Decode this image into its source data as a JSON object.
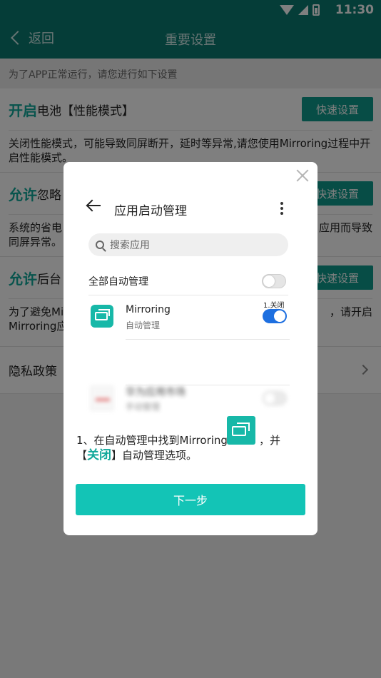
{
  "status": {
    "time": "11:30"
  },
  "nav": {
    "back_label": "返回",
    "title": "重要设置"
  },
  "hint": "为了APP正常运行，请您进行如下设置",
  "sections": [
    {
      "prefix": "开启",
      "title": "电池【性能模式】",
      "button": "快速设置",
      "desc": "关闭性能模式，可能导致同屏断开，延时等异常,请您使用Mirroring过程中开启性能模式。"
    },
    {
      "prefix": "允许",
      "title": "忽略",
      "button": "快速设置",
      "desc": "系统的省电",
      "desc_right": "应用而导致",
      "desc2": "同屏异常。"
    },
    {
      "prefix": "允许",
      "title": "后台",
      "button": "快速设置",
      "desc": "为了避免Mi",
      "desc_right": "，请开启",
      "desc2": "Mirroring应"
    }
  ],
  "privacy": {
    "label": "隐私政策"
  },
  "dialog": {
    "mock": {
      "title": "应用启动管理",
      "search_placeholder": "搜索应用",
      "all_label": "全部自动管理",
      "app_name": "Mirroring",
      "app_sub": "自动管理",
      "close_hint": "1.关闭",
      "blur_name": "华为应用市场",
      "blur_sub": "手动管理"
    },
    "instr_line1_a": "1、在自动管理中找到Mirroring",
    "instr_line1_b": "，并",
    "instr_line2_a": "【",
    "instr_line2_hl": "关闭",
    "instr_line2_b": "】自动管理选项。",
    "next_label": "下一步"
  },
  "colors": {
    "header": "#0a7a70",
    "accent": "#11a89a",
    "button": "#13c4b6",
    "toggle_on": "#1d6fe0"
  }
}
